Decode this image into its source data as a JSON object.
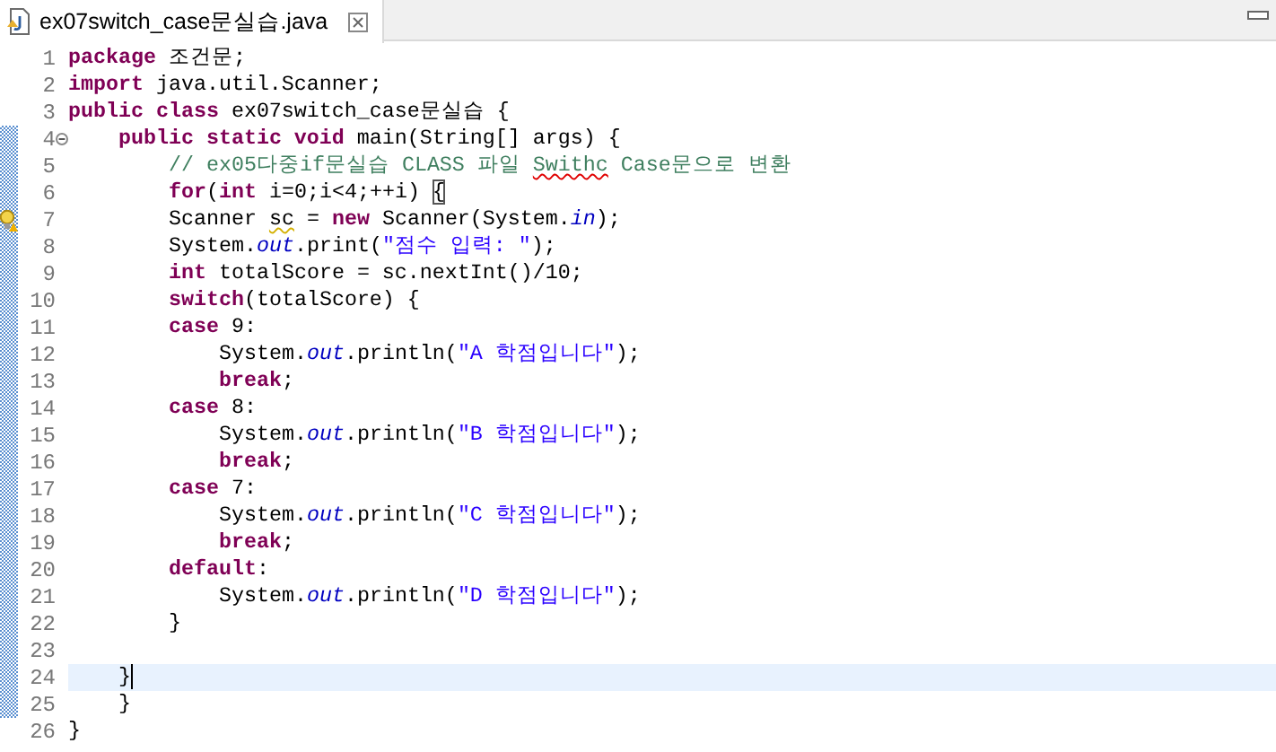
{
  "tab": {
    "title": "ex07switch_case문실습.java",
    "selected": true
  },
  "code_lines": [
    {
      "number": "1",
      "kind": "plain",
      "current": false,
      "tokens": [
        {
          "kind": "keyword",
          "text": "package"
        },
        {
          "kind": "plain",
          "text": " 조건문;"
        }
      ]
    },
    {
      "number": "2",
      "kind": "plain",
      "current": false,
      "tokens": [
        {
          "kind": "keyword",
          "text": "import"
        },
        {
          "kind": "plain",
          "text": " java.util.Scanner;"
        }
      ]
    },
    {
      "number": "3",
      "kind": "plain",
      "current": false,
      "tokens": [
        {
          "kind": "keyword",
          "text": "public class"
        },
        {
          "kind": "plain",
          "text": " ex07switch_case문실습 {"
        }
      ]
    },
    {
      "number": "4",
      "kind": "fold",
      "current": false,
      "tokens": [
        {
          "kind": "keyword",
          "text": "    public static void"
        },
        {
          "kind": "plain",
          "text": " main(String[] args) {"
        }
      ]
    },
    {
      "number": "5",
      "kind": "plain",
      "current": false,
      "tokens": [
        {
          "kind": "comment",
          "text": "        // ex05다중if문실습 CLASS 파일 "
        },
        {
          "kind": "comment-misspelled",
          "text": "Swithc"
        },
        {
          "kind": "comment",
          "text": " Case문으로 변환"
        }
      ]
    },
    {
      "number": "6",
      "kind": "plain",
      "current": false,
      "tokens": [
        {
          "kind": "keyword",
          "text": "        for"
        },
        {
          "kind": "plain",
          "text": "("
        },
        {
          "kind": "keyword",
          "text": "int"
        },
        {
          "kind": "plain",
          "text": " i=0;i<4;++i) "
        },
        {
          "kind": "bracket-match",
          "text": "{"
        }
      ]
    },
    {
      "number": "7",
      "kind": "warning",
      "current": false,
      "tokens": [
        {
          "kind": "plain",
          "text": "        Scanner "
        },
        {
          "kind": "plain-warned",
          "text": "sc"
        },
        {
          "kind": "plain",
          "text": " = "
        },
        {
          "kind": "keyword",
          "text": "new"
        },
        {
          "kind": "plain",
          "text": " Scanner(System."
        },
        {
          "kind": "field",
          "text": "in"
        },
        {
          "kind": "plain",
          "text": ");"
        }
      ]
    },
    {
      "number": "8",
      "kind": "plain",
      "current": false,
      "tokens": [
        {
          "kind": "plain",
          "text": "        System."
        },
        {
          "kind": "field",
          "text": "out"
        },
        {
          "kind": "plain",
          "text": ".print("
        },
        {
          "kind": "string",
          "text": "\"점수 입력: \""
        },
        {
          "kind": "plain",
          "text": ");"
        }
      ]
    },
    {
      "number": "9",
      "kind": "plain",
      "current": false,
      "tokens": [
        {
          "kind": "keyword",
          "text": "        int"
        },
        {
          "kind": "plain",
          "text": " totalScore = sc.nextInt()/10;"
        }
      ]
    },
    {
      "number": "10",
      "kind": "plain",
      "current": false,
      "tokens": [
        {
          "kind": "keyword",
          "text": "        switch"
        },
        {
          "kind": "plain",
          "text": "(totalScore) {"
        }
      ]
    },
    {
      "number": "11",
      "kind": "plain",
      "current": false,
      "tokens": [
        {
          "kind": "keyword",
          "text": "        case"
        },
        {
          "kind": "plain",
          "text": " 9:"
        }
      ]
    },
    {
      "number": "12",
      "kind": "plain",
      "current": false,
      "tokens": [
        {
          "kind": "plain",
          "text": "            System."
        },
        {
          "kind": "field",
          "text": "out"
        },
        {
          "kind": "plain",
          "text": ".println("
        },
        {
          "kind": "string",
          "text": "\"A 학점입니다\""
        },
        {
          "kind": "plain",
          "text": ");"
        }
      ]
    },
    {
      "number": "13",
      "kind": "plain",
      "current": false,
      "tokens": [
        {
          "kind": "keyword",
          "text": "            break"
        },
        {
          "kind": "plain",
          "text": ";"
        }
      ]
    },
    {
      "number": "14",
      "kind": "plain",
      "current": false,
      "tokens": [
        {
          "kind": "keyword",
          "text": "        case"
        },
        {
          "kind": "plain",
          "text": " 8:"
        }
      ]
    },
    {
      "number": "15",
      "kind": "plain",
      "current": false,
      "tokens": [
        {
          "kind": "plain",
          "text": "            System."
        },
        {
          "kind": "field",
          "text": "out"
        },
        {
          "kind": "plain",
          "text": ".println("
        },
        {
          "kind": "string",
          "text": "\"B 학점입니다\""
        },
        {
          "kind": "plain",
          "text": ");"
        }
      ]
    },
    {
      "number": "16",
      "kind": "plain",
      "current": false,
      "tokens": [
        {
          "kind": "keyword",
          "text": "            break"
        },
        {
          "kind": "plain",
          "text": ";"
        }
      ]
    },
    {
      "number": "17",
      "kind": "plain",
      "current": false,
      "tokens": [
        {
          "kind": "keyword",
          "text": "        case"
        },
        {
          "kind": "plain",
          "text": " 7:"
        }
      ]
    },
    {
      "number": "18",
      "kind": "plain",
      "current": false,
      "tokens": [
        {
          "kind": "plain",
          "text": "            System."
        },
        {
          "kind": "field",
          "text": "out"
        },
        {
          "kind": "plain",
          "text": ".println("
        },
        {
          "kind": "string",
          "text": "\"C 학점입니다\""
        },
        {
          "kind": "plain",
          "text": ");"
        }
      ]
    },
    {
      "number": "19",
      "kind": "plain",
      "current": false,
      "tokens": [
        {
          "kind": "keyword",
          "text": "            break"
        },
        {
          "kind": "plain",
          "text": ";"
        }
      ]
    },
    {
      "number": "20",
      "kind": "plain",
      "current": false,
      "tokens": [
        {
          "kind": "keyword",
          "text": "        default"
        },
        {
          "kind": "plain",
          "text": ":"
        }
      ]
    },
    {
      "number": "21",
      "kind": "plain",
      "current": false,
      "tokens": [
        {
          "kind": "plain",
          "text": "            System."
        },
        {
          "kind": "field",
          "text": "out"
        },
        {
          "kind": "plain",
          "text": ".println("
        },
        {
          "kind": "string",
          "text": "\"D 학점입니다\""
        },
        {
          "kind": "plain",
          "text": ");"
        }
      ]
    },
    {
      "number": "22",
      "kind": "plain",
      "current": false,
      "tokens": [
        {
          "kind": "plain",
          "text": "        }"
        }
      ]
    },
    {
      "number": "23",
      "kind": "plain",
      "current": false
    },
    {
      "number": "24",
      "kind": "plain",
      "current": true,
      "tokens": [
        {
          "kind": "plain",
          "text": "    }"
        }
      ]
    },
    {
      "number": "25",
      "kind": "plain",
      "current": false,
      "tokens": [
        {
          "kind": "plain",
          "text": "    }"
        }
      ]
    },
    {
      "number": "26",
      "kind": "plain",
      "current": false,
      "tokens": [
        {
          "kind": "plain",
          "text": "}"
        }
      ]
    }
  ]
}
